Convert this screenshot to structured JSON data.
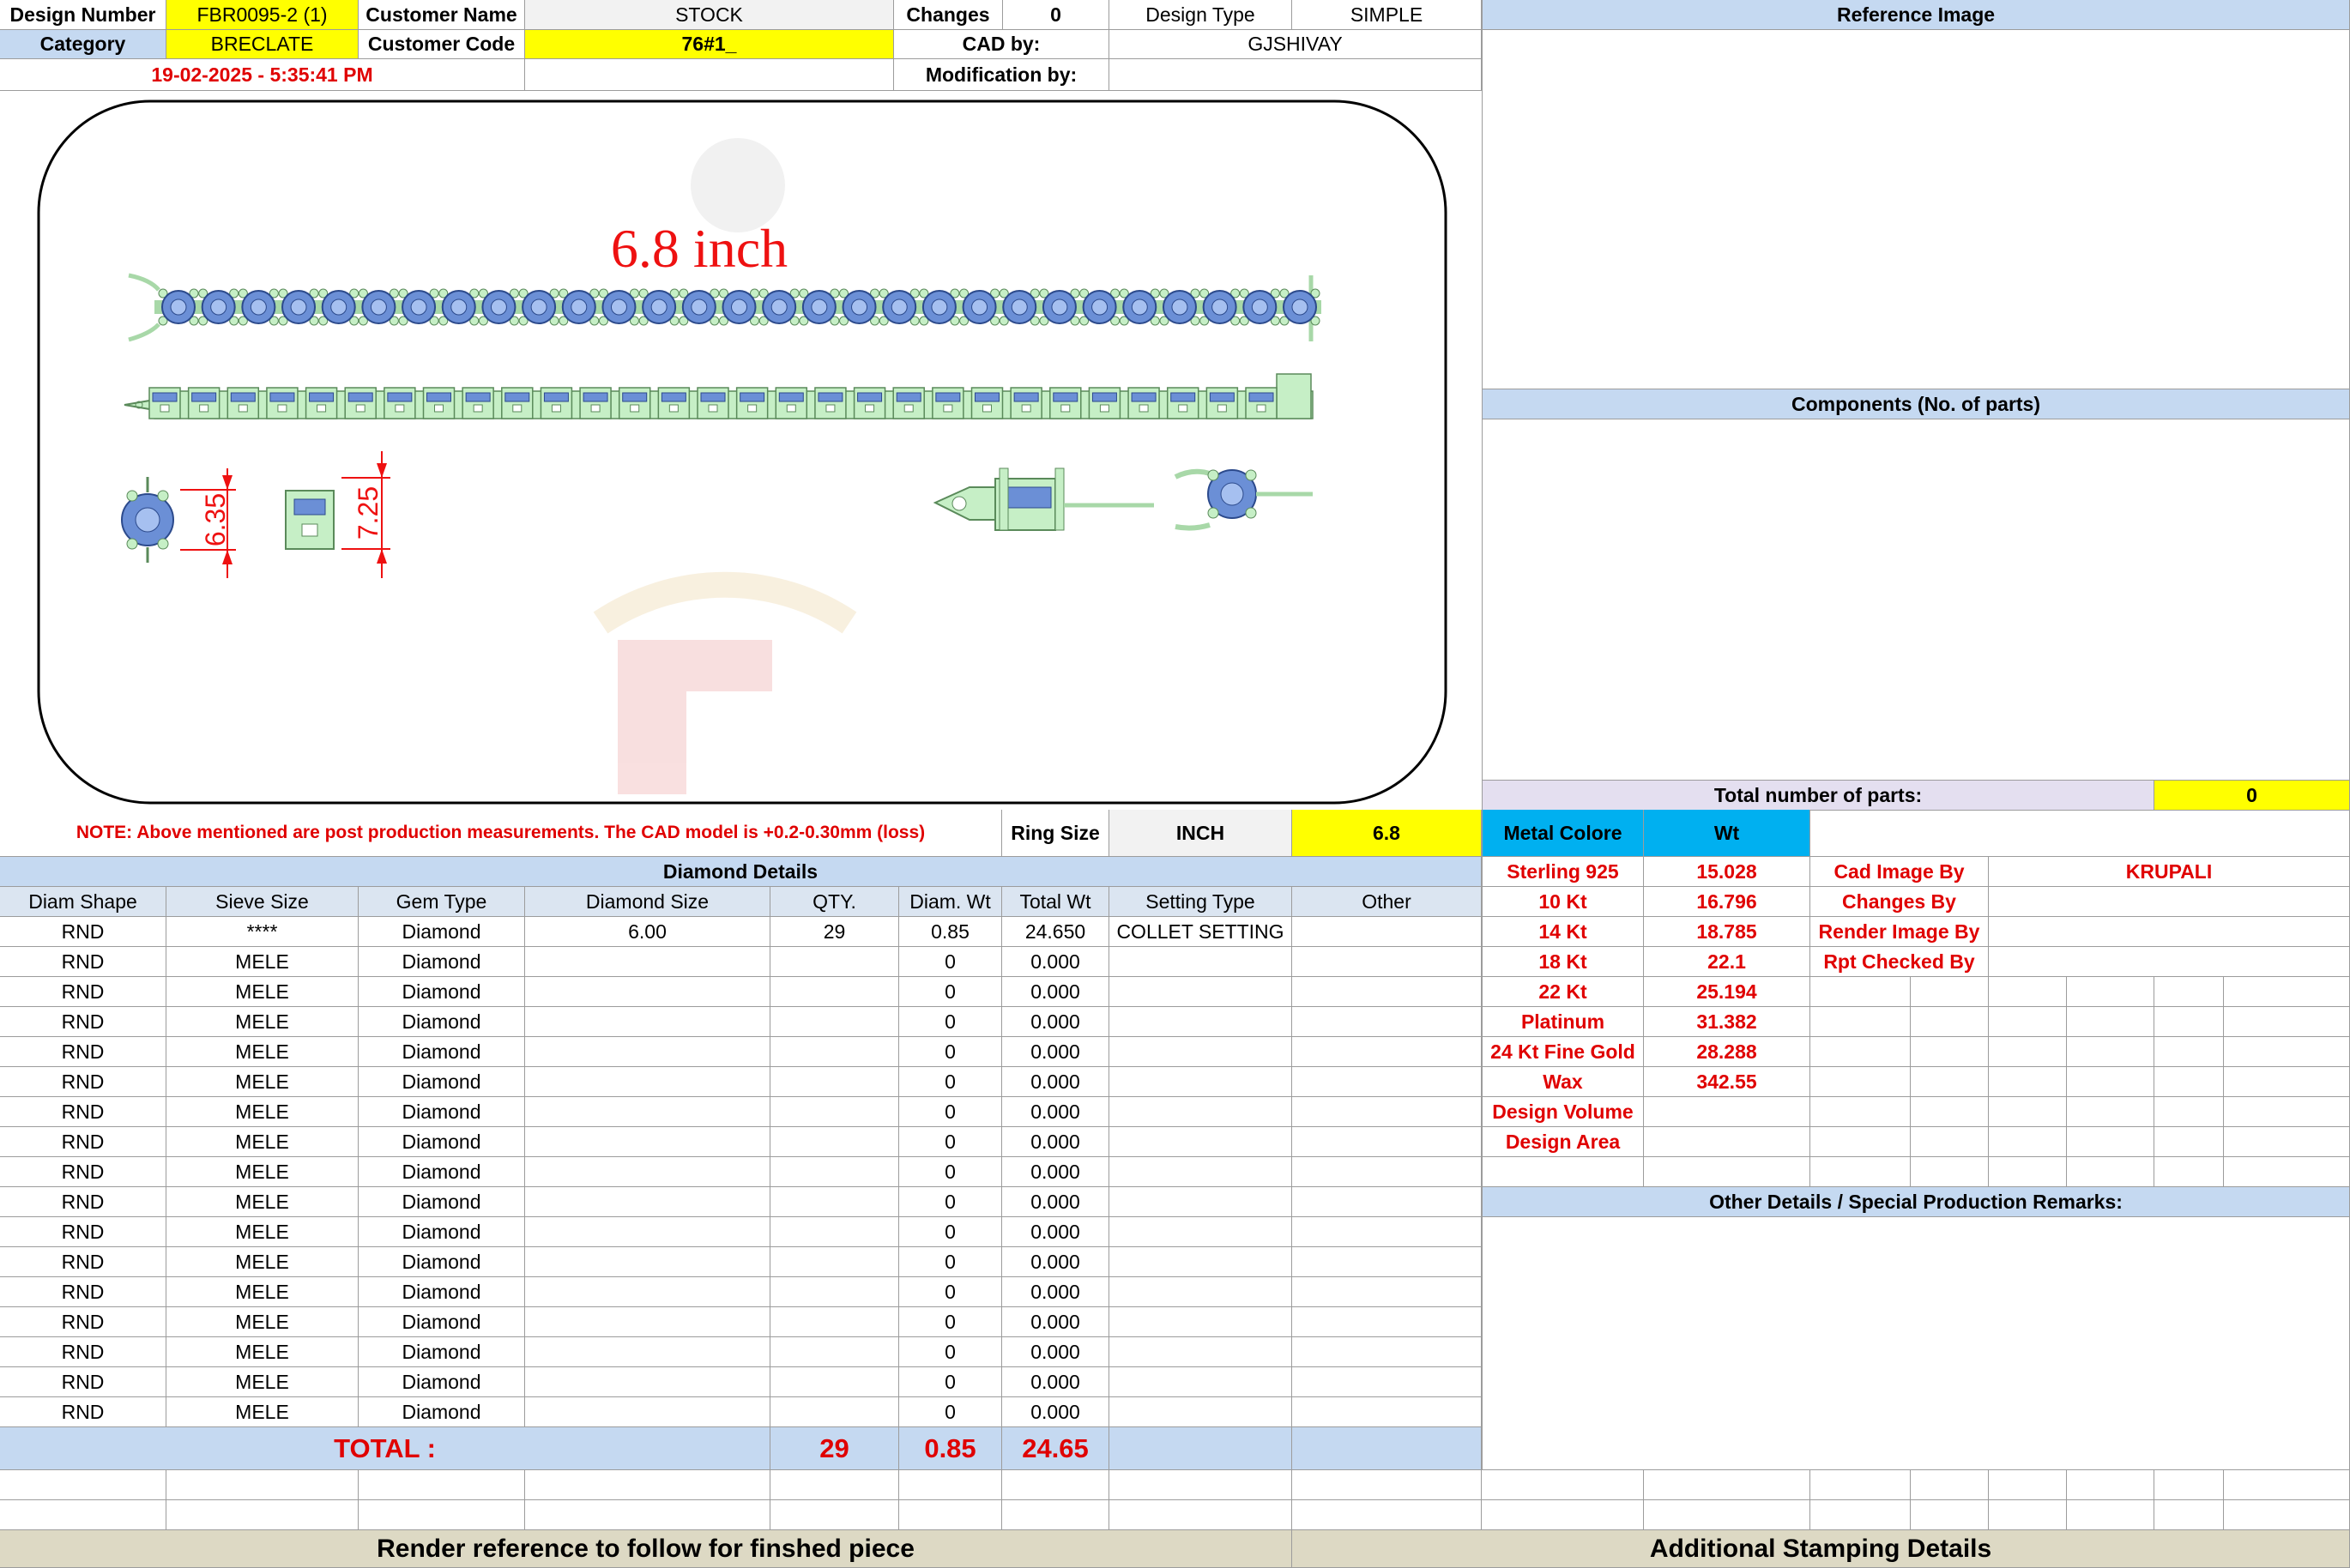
{
  "header": {
    "design_number_label": "Design Number",
    "design_number": "FBR0095-2 (1)",
    "customer_name_label": "Customer Name",
    "customer_name": "STOCK",
    "changes_label": "Changes",
    "changes": "0",
    "design_type_label": "Design Type",
    "design_type": "SIMPLE",
    "category_label": "Category",
    "category": "BRECLATE",
    "customer_code_label": "Customer Code",
    "customer_code": "76#1_",
    "cad_by_label": "CAD by:",
    "cad_by": "GJSHIVAY",
    "datetime": "19-02-2025 - 5:35:41 PM",
    "modification_by_label": "Modification by:",
    "modification_by": ""
  },
  "right": {
    "reference_image_label": "Reference Image",
    "components_label": "Components (No. of parts)",
    "total_parts_label": "Total number of parts:",
    "total_parts": "0",
    "other_details_label": "Other Details / Special Production Remarks:"
  },
  "drawing": {
    "length_label": "6.8 inch",
    "dim_stone": "6.35",
    "dim_setting": "7.25"
  },
  "note": "NOTE: Above mentioned are post production measurements. The CAD model is +0.2-0.30mm (loss)",
  "ring_size": {
    "label": "Ring Size",
    "unit": "INCH",
    "value": "6.8"
  },
  "metal": {
    "colore_label": "Metal Colore",
    "wt_label": "Wt",
    "rows": [
      {
        "name": "Sterling 925",
        "wt": "15.028"
      },
      {
        "name": "10 Kt",
        "wt": "16.796"
      },
      {
        "name": "14 Kt",
        "wt": "18.785"
      },
      {
        "name": "18 Kt",
        "wt": "22.1"
      },
      {
        "name": "22 Kt",
        "wt": "25.194"
      },
      {
        "name": "Platinum",
        "wt": "31.382"
      },
      {
        "name": "24 Kt Fine Gold",
        "wt": "28.288"
      },
      {
        "name": "Wax",
        "wt": "342.55"
      },
      {
        "name": "Design Volume",
        "wt": ""
      },
      {
        "name": "Design Area",
        "wt": ""
      }
    ]
  },
  "credits": {
    "rows": [
      {
        "label": "Cad Image By",
        "value": "KRUPALI"
      },
      {
        "label": "Changes By",
        "value": ""
      },
      {
        "label": "Render Image By",
        "value": ""
      },
      {
        "label": "Rpt Checked By",
        "value": ""
      }
    ]
  },
  "diamond": {
    "title": "Diamond Details",
    "columns": [
      "Diam Shape",
      "Sieve Size",
      "Gem Type",
      "Diamond Size",
      "QTY.",
      "Diam. Wt",
      "Total Wt",
      "Setting Type",
      "Other"
    ],
    "rows": [
      [
        "RND",
        "****",
        "Diamond",
        "6.00",
        "29",
        "0.85",
        "24.650",
        "COLLET SETTING",
        ""
      ],
      [
        "RND",
        "MELE",
        "Diamond",
        "",
        "",
        "0",
        "0.000",
        "",
        ""
      ],
      [
        "RND",
        "MELE",
        "Diamond",
        "",
        "",
        "0",
        "0.000",
        "",
        ""
      ],
      [
        "RND",
        "MELE",
        "Diamond",
        "",
        "",
        "0",
        "0.000",
        "",
        ""
      ],
      [
        "RND",
        "MELE",
        "Diamond",
        "",
        "",
        "0",
        "0.000",
        "",
        ""
      ],
      [
        "RND",
        "MELE",
        "Diamond",
        "",
        "",
        "0",
        "0.000",
        "",
        ""
      ],
      [
        "RND",
        "MELE",
        "Diamond",
        "",
        "",
        "0",
        "0.000",
        "",
        ""
      ],
      [
        "RND",
        "MELE",
        "Diamond",
        "",
        "",
        "0",
        "0.000",
        "",
        ""
      ],
      [
        "RND",
        "MELE",
        "Diamond",
        "",
        "",
        "0",
        "0.000",
        "",
        ""
      ],
      [
        "RND",
        "MELE",
        "Diamond",
        "",
        "",
        "0",
        "0.000",
        "",
        ""
      ],
      [
        "RND",
        "MELE",
        "Diamond",
        "",
        "",
        "0",
        "0.000",
        "",
        ""
      ],
      [
        "RND",
        "MELE",
        "Diamond",
        "",
        "",
        "0",
        "0.000",
        "",
        ""
      ],
      [
        "RND",
        "MELE",
        "Diamond",
        "",
        "",
        "0",
        "0.000",
        "",
        ""
      ],
      [
        "RND",
        "MELE",
        "Diamond",
        "",
        "",
        "0",
        "0.000",
        "",
        ""
      ],
      [
        "RND",
        "MELE",
        "Diamond",
        "",
        "",
        "0",
        "0.000",
        "",
        ""
      ],
      [
        "RND",
        "MELE",
        "Diamond",
        "",
        "",
        "0",
        "0.000",
        "",
        ""
      ],
      [
        "RND",
        "MELE",
        "Diamond",
        "",
        "",
        "0",
        "0.000",
        "",
        ""
      ]
    ],
    "total_label": "TOTAL :",
    "total_qty": "29",
    "total_diam_wt": "0.85",
    "total_wt": "24.65"
  },
  "footer": {
    "render_reference": "Render reference to follow for finshed piece",
    "additional_stamping": "Additional Stamping Details"
  },
  "colors": {
    "header_blue": "#c5d9f1",
    "highlight_yellow": "#ffff00",
    "metal_cyan": "#00b0f0",
    "footer_tan": "#ddd9c4",
    "stone_blue": "#6b8fd6",
    "metal_green": "#c6efc6",
    "dim_red": "#ee1111"
  }
}
